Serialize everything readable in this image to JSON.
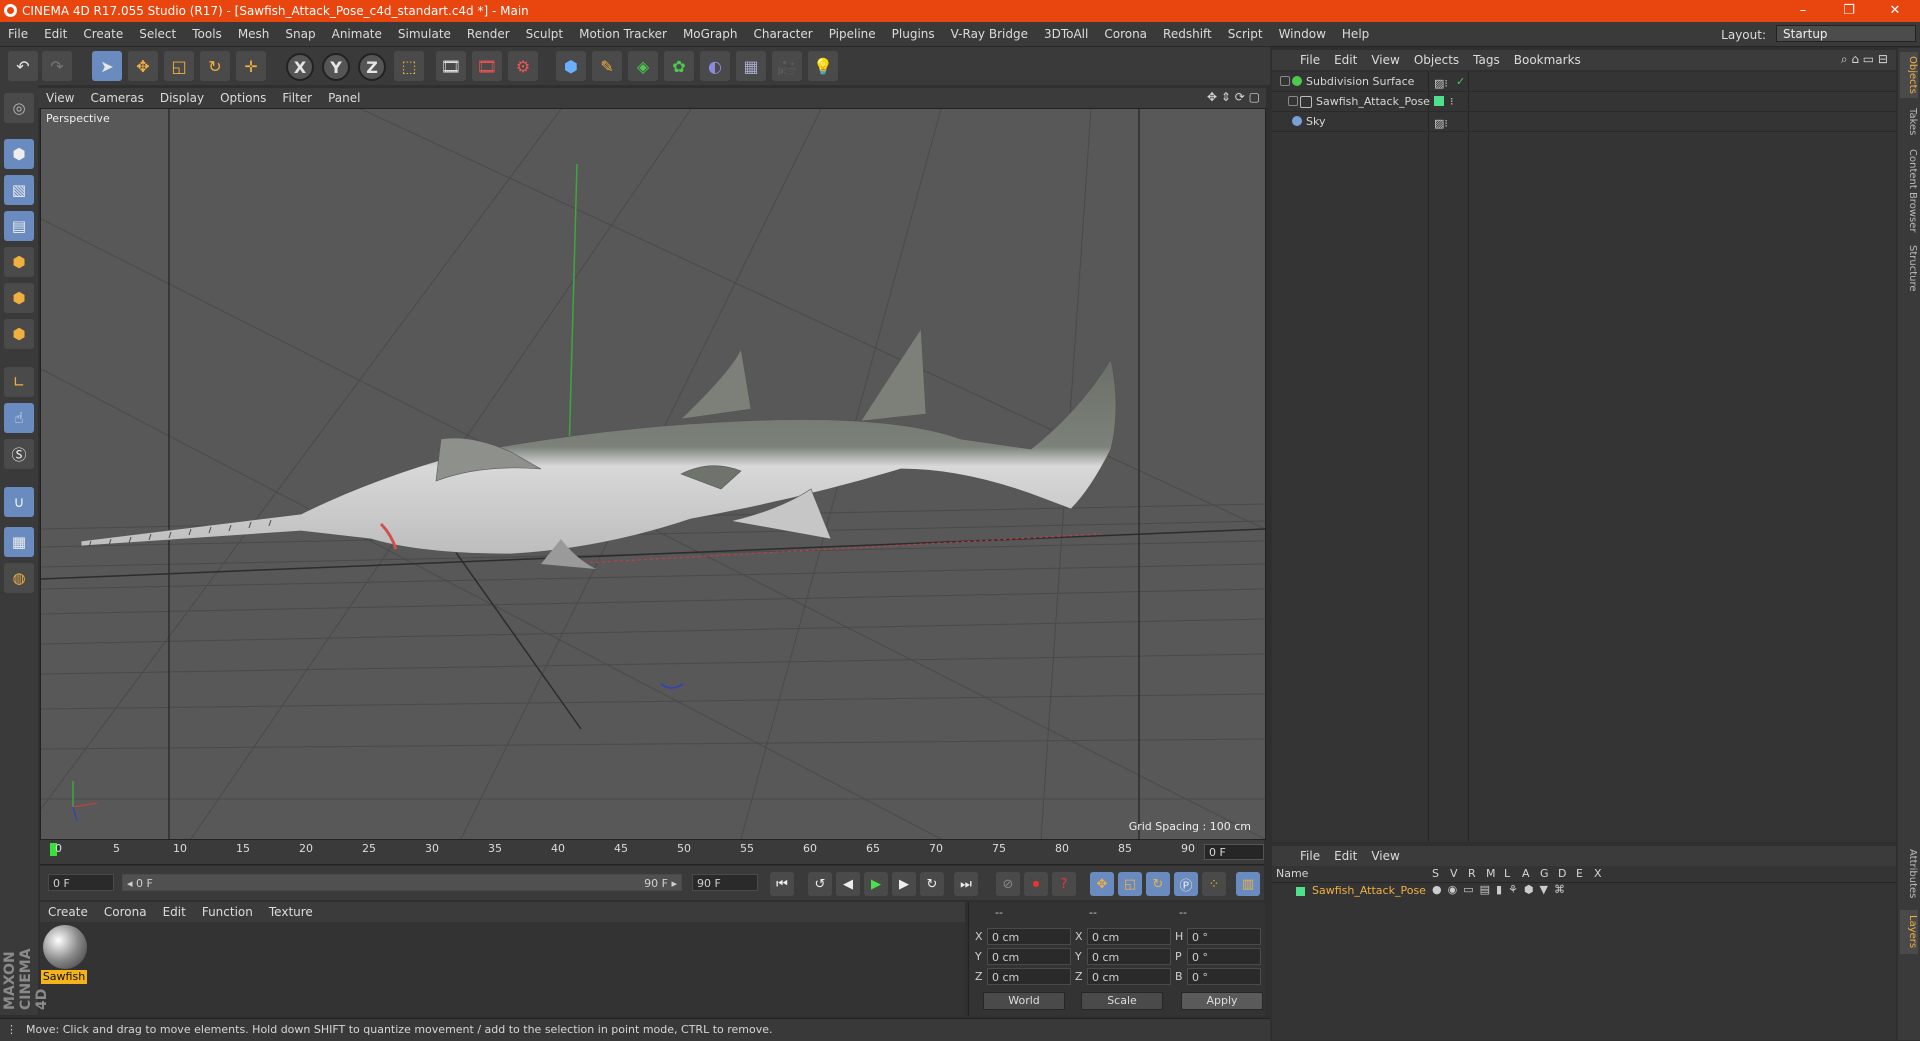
{
  "window": {
    "title": "CINEMA 4D R17.055 Studio (R17) - [Sawfish_Attack_Pose_c4d_standart.c4d *] - Main",
    "min": "–",
    "max": "❐",
    "close": "✕"
  },
  "menubar": [
    "File",
    "Edit",
    "Create",
    "Select",
    "Tools",
    "Mesh",
    "Snap",
    "Animate",
    "Simulate",
    "Render",
    "Sculpt",
    "Motion Tracker",
    "MoGraph",
    "Character",
    "Pipeline",
    "Plugins",
    "V-Ray Bridge",
    "3DToAll",
    "Corona",
    "Redshift",
    "Script",
    "Window",
    "Help"
  ],
  "layout": {
    "label": "Layout:",
    "value": "Startup"
  },
  "toolbar": {
    "icons": [
      "undo-icon",
      "redo-icon",
      "select-arrow-icon",
      "move-icon",
      "scale-icon",
      "rotate-icon",
      "move-all-icon",
      "x-axis-icon",
      "y-axis-icon",
      "z-axis-icon",
      "world-coord-icon",
      "render-view-icon",
      "render-picture-icon",
      "render-settings-icon",
      "cube-icon",
      "pen-icon",
      "subdivision-icon",
      "array-icon",
      "deformer-icon",
      "floor-icon",
      "camera-icon",
      "light-icon"
    ],
    "axis": [
      "X",
      "Y",
      "Z"
    ]
  },
  "viewport": {
    "menu": [
      "View",
      "Cameras",
      "Display",
      "Options",
      "Filter",
      "Panel"
    ],
    "label": "Perspective",
    "grid_spacing": "Grid Spacing : 100 cm"
  },
  "timeline": {
    "ticks": [
      "0",
      "5",
      "10",
      "15",
      "20",
      "25",
      "30",
      "35",
      "40",
      "45",
      "50",
      "55",
      "60",
      "65",
      "70",
      "75",
      "80",
      "85",
      "90"
    ],
    "current_frame": "0 F",
    "start_field": "0 F",
    "range_start": "◂ 0 F",
    "range_end": "90 F ▸",
    "end_field": "90 F"
  },
  "material_manager": {
    "menu": [
      "Create",
      "Corona",
      "Edit",
      "Function",
      "Texture"
    ],
    "material_name": "Sawfish"
  },
  "maxon_logo": "MAXON CINEMA 4D",
  "coordinates": {
    "headers": [
      "--",
      "--",
      "--"
    ],
    "rows": [
      {
        "a": "X",
        "av": "0 cm",
        "b": "X",
        "bv": "0 cm",
        "c": "H",
        "cv": "0 °"
      },
      {
        "a": "Y",
        "av": "0 cm",
        "b": "Y",
        "bv": "0 cm",
        "c": "P",
        "cv": "0 °"
      },
      {
        "a": "Z",
        "av": "0 cm",
        "b": "Z",
        "bv": "0 cm",
        "c": "B",
        "cv": "0 °"
      }
    ],
    "mode1": "World",
    "mode2": "Scale",
    "apply": "Apply"
  },
  "status": "Move: Click and drag to move elements. Hold down SHIFT to quantize movement / add to the selection in point mode, CTRL to remove.",
  "object_manager": {
    "menu": [
      "File",
      "Edit",
      "View",
      "Objects",
      "Tags",
      "Bookmarks"
    ],
    "objects": [
      {
        "name": "Subdivision Surface",
        "color": "#4ec94e"
      },
      {
        "name": "Sawfish_Attack_Pose",
        "color": "#6aa0d8"
      },
      {
        "name": "Sky",
        "color": "#7aa0d8"
      }
    ]
  },
  "layer_manager": {
    "menu": [
      "File",
      "Edit",
      "View"
    ],
    "columns": [
      "Name",
      "S",
      "V",
      "R",
      "M",
      "L",
      "A",
      "G",
      "D",
      "E",
      "X"
    ],
    "layer": "Sawfish_Attack_Pose"
  },
  "right_tabs": [
    "Objects",
    "Takes",
    "Content Browser",
    "Structure",
    "Attributes",
    "Layers"
  ]
}
